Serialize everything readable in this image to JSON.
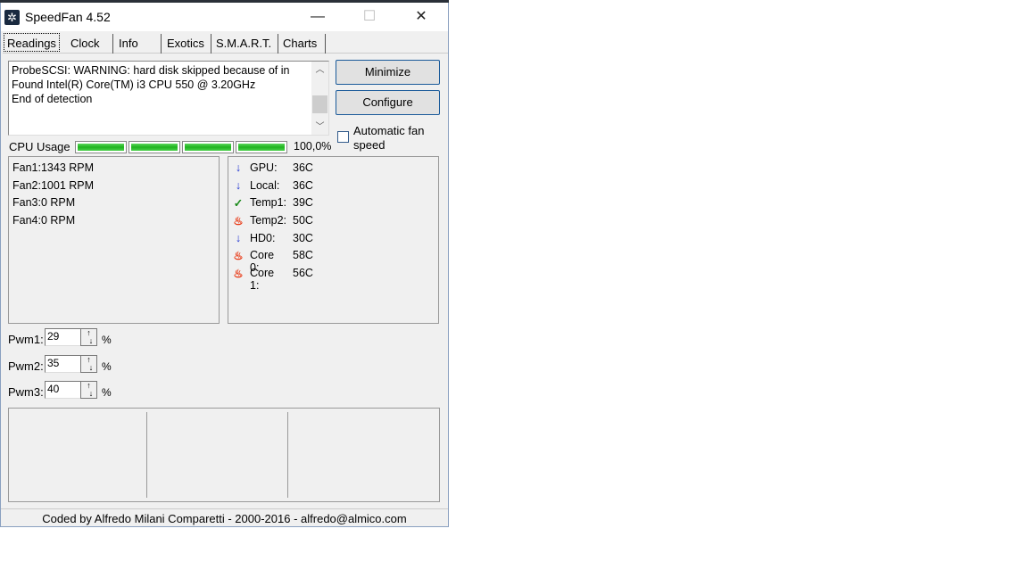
{
  "window": {
    "title": "SpeedFan 4.52",
    "controls": {
      "minimize": "—",
      "maximize": "☐",
      "close": "✕"
    }
  },
  "tabs": [
    "Readings",
    "Clock",
    "Info",
    "Exotics",
    "S.M.A.R.T.",
    "Charts"
  ],
  "log": [
    "ProbeSCSI: WARNING: hard disk skipped because of in",
    "Found Intel(R) Core(TM) i3 CPU 550 @ 3.20GHz",
    "End of detection"
  ],
  "buttons": {
    "minimize": "Minimize",
    "configure": "Configure"
  },
  "auto_fan": {
    "label": "Automatic fan speed",
    "checked": false
  },
  "cpu": {
    "label": "CPU Usage",
    "bars": [
      1,
      1,
      1,
      1
    ],
    "value": "100,0%"
  },
  "fans": [
    {
      "label": "Fan1:",
      "value": "1343 RPM"
    },
    {
      "label": "Fan2:",
      "value": "1001 RPM"
    },
    {
      "label": "Fan3:",
      "value": "0 RPM"
    },
    {
      "label": "Fan4:",
      "value": "0 RPM"
    }
  ],
  "temps": [
    {
      "icon": "arrow-down",
      "label": "GPU:",
      "value": "36C"
    },
    {
      "icon": "arrow-down",
      "label": "Local:",
      "value": "36C"
    },
    {
      "icon": "check",
      "label": "Temp1:",
      "value": "39C"
    },
    {
      "icon": "flame",
      "label": "Temp2:",
      "value": "50C"
    },
    {
      "icon": "arrow-down",
      "label": "HD0:",
      "value": "30C"
    },
    {
      "icon": "flame",
      "label": "Core 0:",
      "value": "58C"
    },
    {
      "icon": "flame",
      "label": "Core 1:",
      "value": "56C"
    }
  ],
  "pwm": [
    {
      "label": "Pwm1:",
      "value": "29",
      "unit": "%"
    },
    {
      "label": "Pwm2:",
      "value": "35",
      "unit": "%"
    },
    {
      "label": "Pwm3:",
      "value": "40",
      "unit": "%"
    }
  ],
  "footer": "Coded by Alfredo Milani Comparetti - 2000-2016 - alfredo@almico.com"
}
